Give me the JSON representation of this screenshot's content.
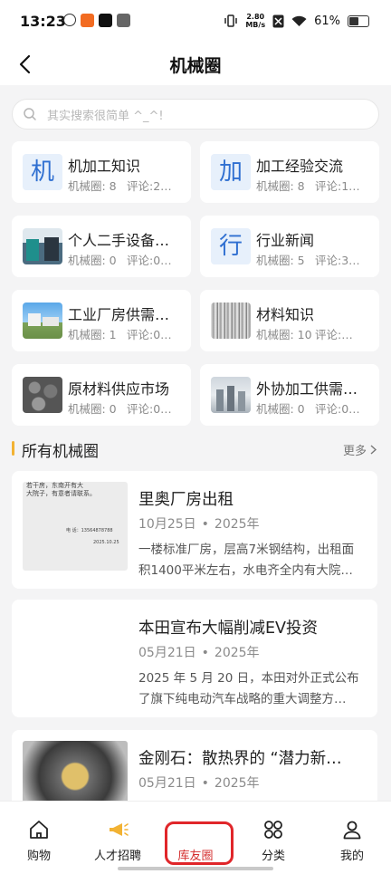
{
  "status_bar": {
    "time": "13:23",
    "net_speed_value": "2.80",
    "net_speed_unit": "MB/s",
    "battery": "61%",
    "battery_level": 0.61
  },
  "header": {
    "title": "机械圈",
    "back_icon": "chevron-left-icon"
  },
  "search": {
    "placeholder": "其实搜索很简单 ^_^!"
  },
  "categories": [
    {
      "title": "机加工知识",
      "icon_char": "机",
      "count_label": "机械圈: 8",
      "comment_label": "评论:2…"
    },
    {
      "title": "加工经验交流",
      "icon_char": "加",
      "count_label": "机械圈: 8",
      "comment_label": "评论:1…"
    },
    {
      "title": "个人二手设备…",
      "icon": "machinery-photo-icon",
      "count_label": "机械圈: 0",
      "comment_label": "评论:0…"
    },
    {
      "title": "行业新闻",
      "icon_char": "行",
      "count_label": "机械圈: 5",
      "comment_label": "评论:3…"
    },
    {
      "title": "工业厂房供需…",
      "icon": "factory-photo-icon",
      "count_label": "机械圈: 1",
      "comment_label": "评论:0…"
    },
    {
      "title": "材料知识",
      "icon": "steel-bars-photo-icon",
      "count_label": "机械圈: 10",
      "comment_label": "评论:…"
    },
    {
      "title": "原材料供应市场",
      "icon": "metal-parts-photo-icon",
      "count_label": "机械圈: 0",
      "comment_label": "评论:0…"
    },
    {
      "title": "外协加工供需…",
      "icon": "workshop-photo-icon",
      "count_label": "机械圈: 0",
      "comment_label": "评论:0…"
    }
  ],
  "section": {
    "title": "所有机械圈",
    "more": "更多",
    "accent_color": "#f2b233"
  },
  "posts": [
    {
      "title": "里奥厂房出租",
      "date": "10月25日",
      "year": "2025年",
      "excerpt_line1": "一楼标准厂房，层高7米钢结构，出租面",
      "excerpt_line2": "积1400平米左右，水电齐全内有大院…",
      "thumb_text_line1": "若干房，东南开有大",
      "thumb_text_line2": "大院子，有意者请联系。",
      "thumb_phone": "电 话：13564878788",
      "thumb_date": "2025.10.25"
    },
    {
      "title": "本田宣布大幅削减EV投资",
      "date": "05月21日",
      "year": "2025年",
      "excerpt_line1": "2025 年 5 月 20 日，本田对外正式公布",
      "excerpt_line2": "了旗下纯电动汽车战略的重大调整方…"
    },
    {
      "title": "金刚石：散热界的 “潜力新…",
      "date": "05月21日",
      "year": "2025年"
    }
  ],
  "tabs": [
    {
      "label": "购物",
      "icon": "home-icon"
    },
    {
      "label": "人才招聘",
      "icon": "megaphone-icon"
    },
    {
      "label": "库友圈",
      "active": true
    },
    {
      "label": "分类",
      "icon": "grid-icon"
    },
    {
      "label": "我的",
      "icon": "user-icon"
    }
  ],
  "colors": {
    "active_tab": "#d42f2f",
    "highlight_ring": "#e0262a",
    "icon_blue": "#2f6fd1"
  }
}
